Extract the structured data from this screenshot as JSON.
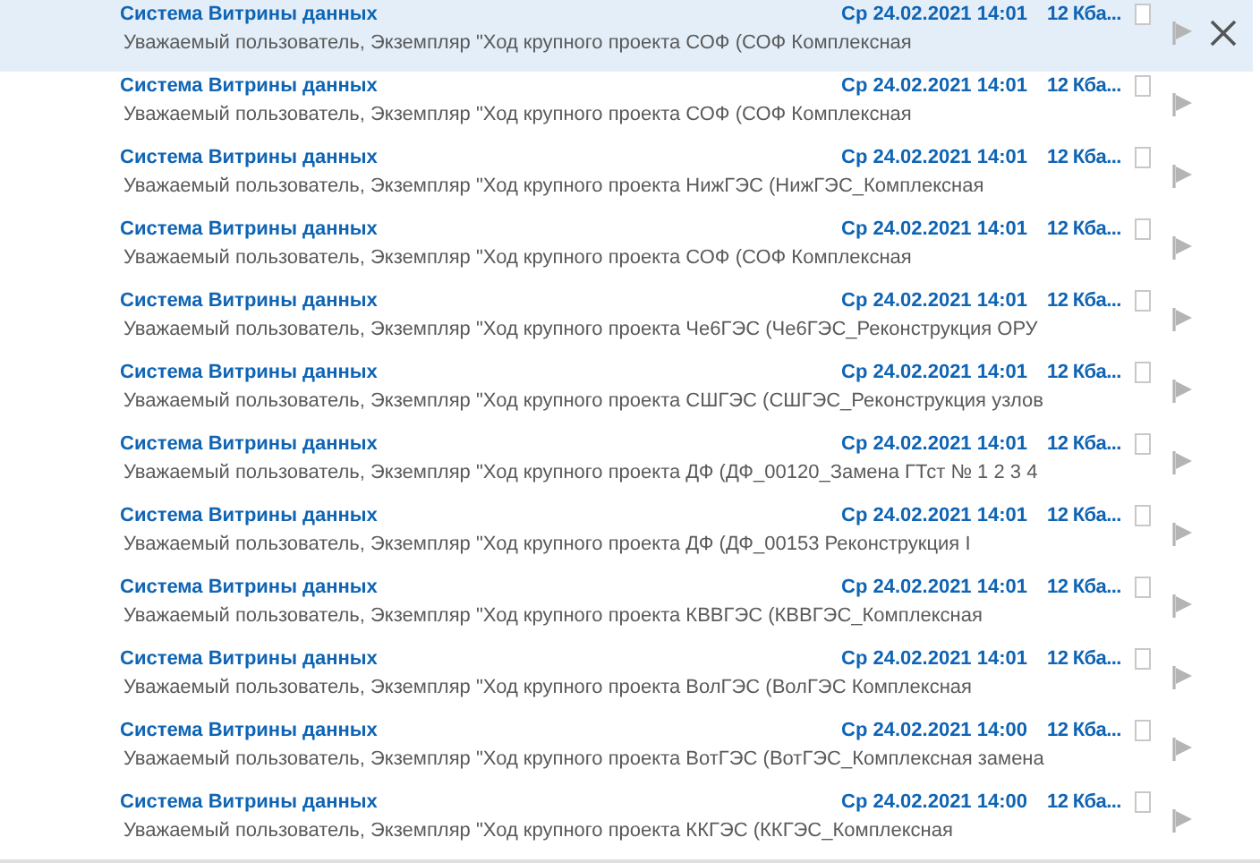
{
  "messages": [
    {
      "sender": "Система Витрины данных",
      "date": "Ср 24.02.2021 14:01",
      "size": "12 Кба...",
      "preview": "Уважаемый пользователь,  Экземпляр \"Ход крупного проекта СОФ (СОФ Комплексная",
      "selected": true
    },
    {
      "sender": "Система Витрины данных",
      "date": "Ср 24.02.2021 14:01",
      "size": "12 Кба...",
      "preview": "Уважаемый пользователь,  Экземпляр \"Ход крупного проекта СОФ (СОФ Комплексная",
      "selected": false
    },
    {
      "sender": "Система Витрины данных",
      "date": "Ср 24.02.2021 14:01",
      "size": "12 Кба...",
      "preview": "Уважаемый пользователь,  Экземпляр \"Ход крупного проекта НижГЭС (НижГЭС_Комплексная",
      "selected": false
    },
    {
      "sender": "Система Витрины данных",
      "date": "Ср 24.02.2021 14:01",
      "size": "12 Кба...",
      "preview": "Уважаемый пользователь,  Экземпляр \"Ход крупного проекта СОФ (СОФ Комплексная",
      "selected": false
    },
    {
      "sender": "Система Витрины данных",
      "date": "Ср 24.02.2021 14:01",
      "size": "12 Кба...",
      "preview": "Уважаемый пользователь,  Экземпляр \"Ход крупного проекта Че6ГЭС (Че6ГЭС_Реконструкция ОРУ",
      "selected": false
    },
    {
      "sender": "Система Витрины данных",
      "date": "Ср 24.02.2021 14:01",
      "size": "12 Кба...",
      "preview": "Уважаемый пользователь,  Экземпляр \"Ход крупного проекта СШГЭС (СШГЭС_Реконструкция узлов",
      "selected": false
    },
    {
      "sender": "Система Витрины данных",
      "date": "Ср 24.02.2021 14:01",
      "size": "12 Кба...",
      "preview": "Уважаемый пользователь,  Экземпляр \"Ход крупного проекта ДФ (ДФ_00120_Замена ГТст № 1 2 3 4",
      "selected": false
    },
    {
      "sender": "Система Витрины данных",
      "date": "Ср 24.02.2021 14:01",
      "size": "12 Кба...",
      "preview": "Уважаемый пользователь,  Экземпляр \"Ход крупного проекта ДФ (ДФ_00153 Реконструкция I",
      "selected": false
    },
    {
      "sender": "Система Витрины данных",
      "date": "Ср 24.02.2021 14:01",
      "size": "12 Кба...",
      "preview": "Уважаемый пользователь,  Экземпляр \"Ход крупного проекта КВВГЭС (КВВГЭС_Комплексная",
      "selected": false
    },
    {
      "sender": "Система Витрины данных",
      "date": "Ср 24.02.2021 14:01",
      "size": "12 Кба...",
      "preview": "Уважаемый пользователь,  Экземпляр \"Ход крупного проекта ВолГЭС (ВолГЭС Комплексная",
      "selected": false
    },
    {
      "sender": "Система Витрины данных",
      "date": "Ср 24.02.2021 14:00",
      "size": "12 Кба...",
      "preview": "Уважаемый пользователь,  Экземпляр \"Ход крупного проекта ВотГЭС (ВотГЭС_Комплексная замена",
      "selected": false
    },
    {
      "sender": "Система Витрины данных",
      "date": "Ср 24.02.2021 14:00",
      "size": "12 Кба...",
      "preview": "Уважаемый пользователь,  Экземпляр \"Ход крупного проекта ККГЭС (ККГЭС_Комплексная",
      "selected": false
    }
  ]
}
